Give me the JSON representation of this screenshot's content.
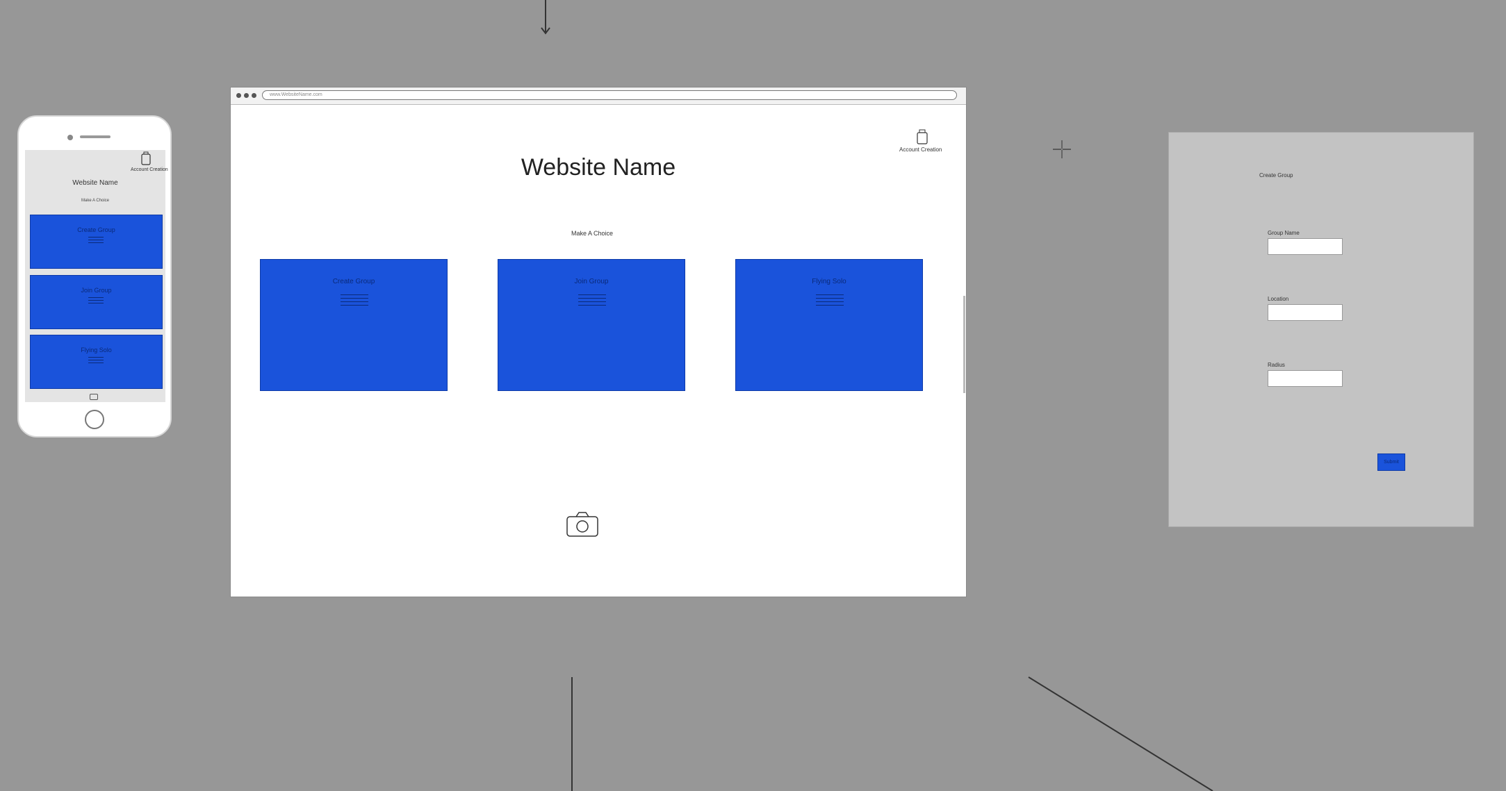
{
  "phone": {
    "account_label": "Account Creation",
    "title": "Website Name",
    "subtitle": "Make A Choice",
    "cards": [
      {
        "label": "Create Group"
      },
      {
        "label": "Join Group"
      },
      {
        "label": "Flying Solo"
      }
    ]
  },
  "browser": {
    "url": "www.WebsiteName.com",
    "account_label": "Account Creation",
    "title": "Website Name",
    "subtitle": "Make A Choice",
    "cards": [
      {
        "label": "Create Group"
      },
      {
        "label": "Join Group"
      },
      {
        "label": "Flying Solo"
      }
    ],
    "camera_icon": "camera-icon"
  },
  "form": {
    "title": "Create Group",
    "fields": [
      {
        "label": "Group Name",
        "value": ""
      },
      {
        "label": "Location",
        "value": ""
      },
      {
        "label": "Radius",
        "value": ""
      }
    ],
    "submit_label": "Submit"
  },
  "icons": {
    "account": "user-icon",
    "cursor": "crosshair-cursor-icon"
  },
  "colors": {
    "background": "#979797",
    "card_blue": "#1a53db",
    "form_panel": "#c3c3c3"
  }
}
